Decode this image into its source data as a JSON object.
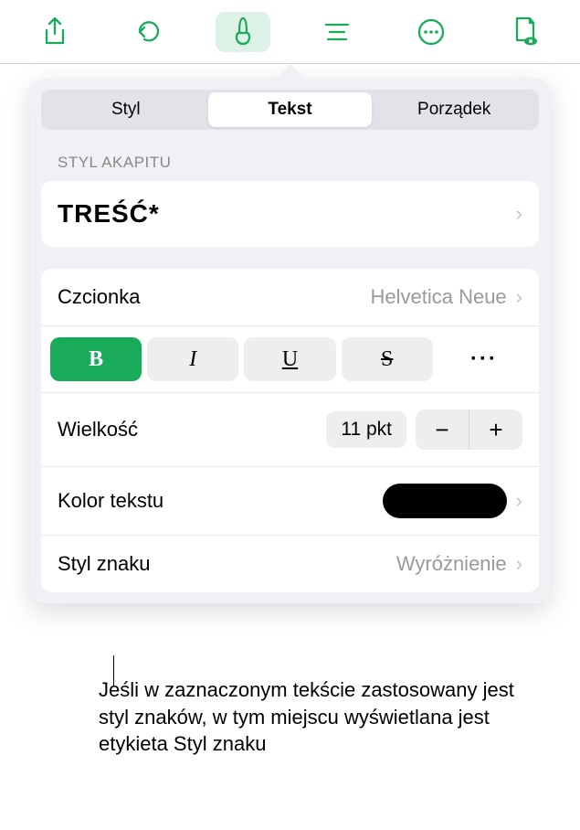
{
  "toolbar": {
    "icons": [
      "share",
      "undo",
      "format",
      "list",
      "more",
      "collab"
    ]
  },
  "tabs": {
    "items": [
      "Styl",
      "Tekst",
      "Porządek"
    ],
    "active": 1
  },
  "section_header": "STYL AKAPITU",
  "paragraph_style": "TREŚĆ*",
  "font": {
    "label": "Czcionka",
    "value": "Helvetica Neue"
  },
  "format_buttons": {
    "bold": "B",
    "italic": "I",
    "underline": "U",
    "strike": "S",
    "more": "···"
  },
  "size": {
    "label": "Wielkość",
    "value": "11 pkt"
  },
  "text_color": {
    "label": "Kolor tekstu",
    "value": "#000000"
  },
  "char_style": {
    "label": "Styl znaku",
    "value": "Wyróżnienie"
  },
  "callout": "Jeśli w zaznaczonym tekście zastosowany jest styl znaków, w tym miejscu wyświetlana jest etykieta Styl znaku"
}
